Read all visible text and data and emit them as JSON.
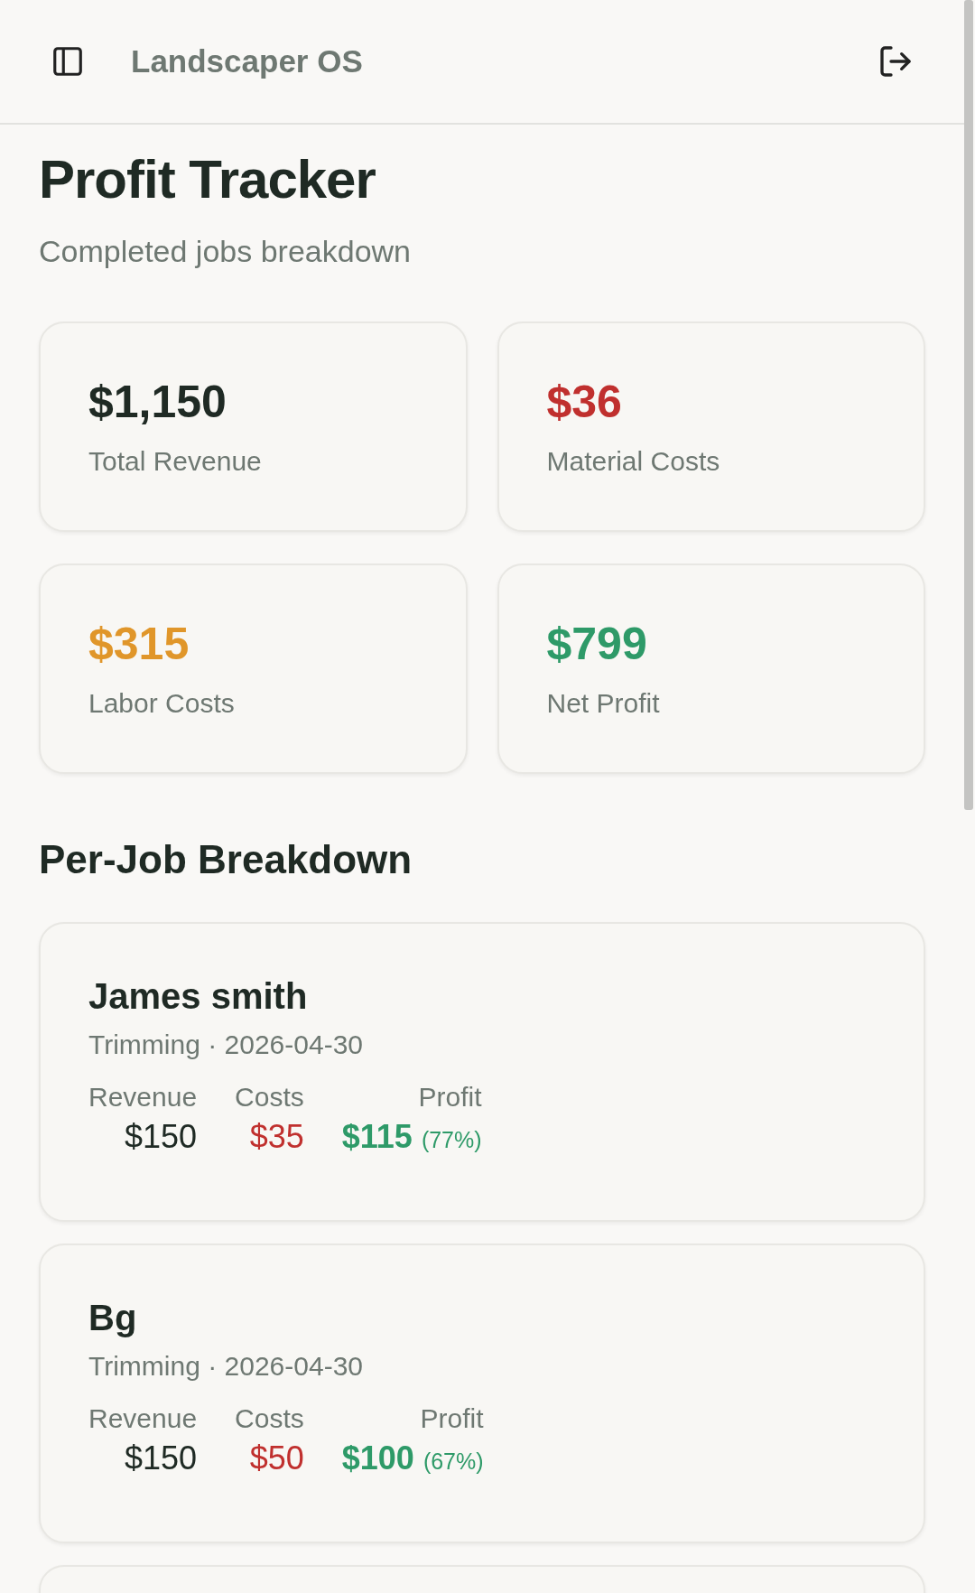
{
  "app_bar": {
    "title": "Landscaper OS"
  },
  "page": {
    "title": "Profit Tracker",
    "subtitle": "Completed jobs breakdown"
  },
  "stats": [
    {
      "value": "$1,150",
      "label": "Total Revenue",
      "color": "#1f2a24"
    },
    {
      "value": "$36",
      "label": "Material Costs",
      "color": "#c0302e"
    },
    {
      "value": "$315",
      "label": "Labor Costs",
      "color": "#e0962a"
    },
    {
      "value": "$799",
      "label": "Net Profit",
      "color": "#2e9a68"
    }
  ],
  "section_title": "Per-Job Breakdown",
  "jobs": [
    {
      "name": "James smith",
      "meta": "Trimming · 2026-04-30",
      "metrics": [
        {
          "kind": "revenue",
          "label": "Revenue",
          "value": "$150"
        },
        {
          "kind": "costs",
          "label": "Costs",
          "value": "$35"
        },
        {
          "kind": "profit",
          "label": "Profit",
          "value": "$115",
          "percent": "(77%)"
        }
      ]
    },
    {
      "name": "Bg",
      "meta": "Trimming · 2026-04-30",
      "metrics": [
        {
          "kind": "revenue",
          "label": "Revenue",
          "value": "$150"
        },
        {
          "kind": "costs",
          "label": "Costs",
          "value": "$50"
        },
        {
          "kind": "profit",
          "label": "Profit",
          "value": "$100",
          "percent": "(67%)"
        }
      ]
    }
  ]
}
